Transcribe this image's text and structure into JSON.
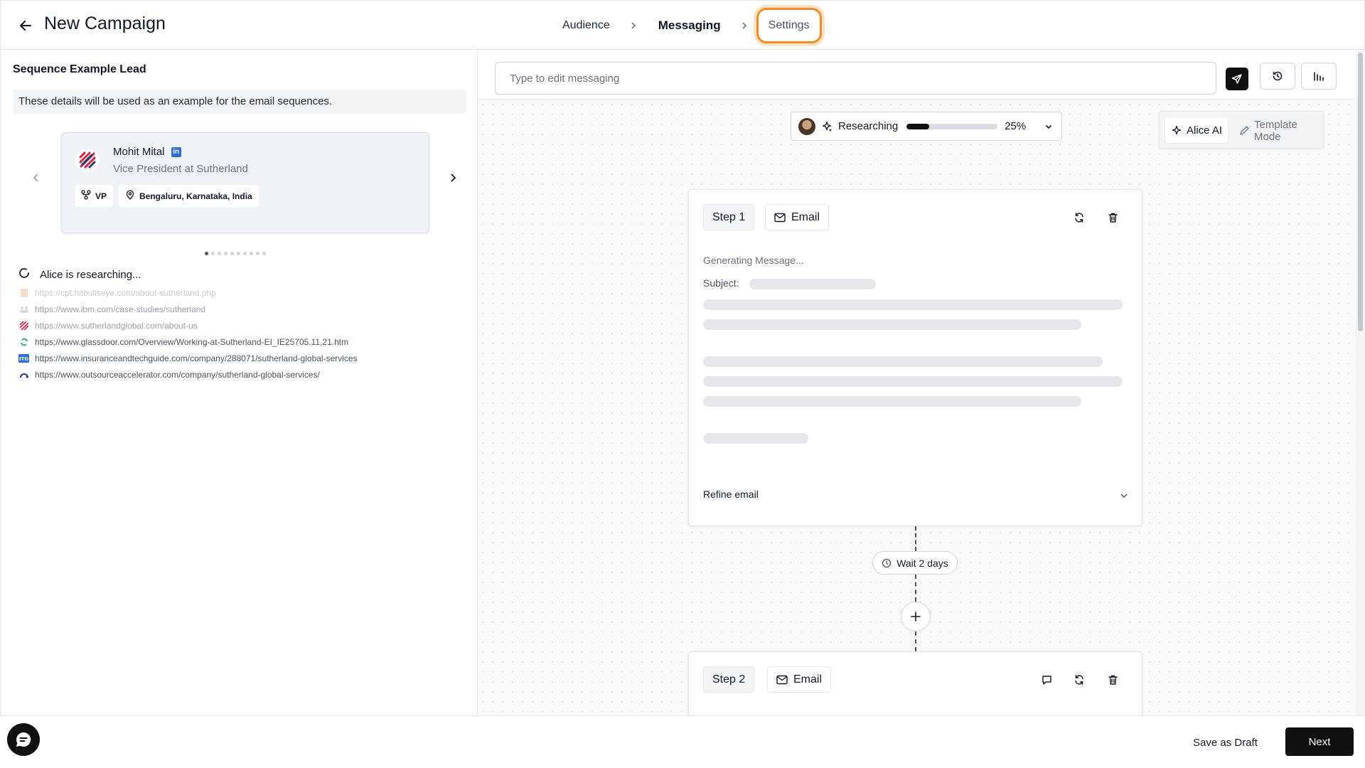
{
  "header": {
    "title": "New Campaign",
    "steps": [
      {
        "label": "Audience"
      },
      {
        "label": "Messaging"
      },
      {
        "label": "Settings"
      }
    ]
  },
  "lead_panel": {
    "title": "Sequence Example Lead",
    "note": "These details will be used as an example for the email sequences.",
    "lead": {
      "name": "Mohit Mital",
      "role": "Vice President at Sutherland",
      "seniority": "VP",
      "location": "Bengaluru, Karnataka, India"
    },
    "carousel": {
      "total": 10,
      "active_index": 0
    },
    "research_status": "Alice is researching...",
    "sources": [
      {
        "url": "https://cpt.hitbullseye.com/about-sutherland.php",
        "opacity": "faded",
        "icon": "document-icon"
      },
      {
        "url": "https://www.ibm.com/case-studies/sutherland",
        "opacity": "mid",
        "icon": "people-icon"
      },
      {
        "url": "https://www.sutherlandglobal.com/about-us",
        "opacity": "mid",
        "icon": "sutherland-logo-icon"
      },
      {
        "url": "https://www.glassdoor.com/Overview/Working-at-Sutherland-EI_IE25705.11,21.htm",
        "opacity": "full",
        "icon": "glassdoor-icon"
      },
      {
        "url": "https://www.insuranceandtechguide.com/company/288071/sutherland-global-services",
        "opacity": "full",
        "icon": "itg-logo-icon"
      },
      {
        "url": "https://www.outsourceaccelerator.com/company/sutherland-global-services/",
        "opacity": "full",
        "icon": "oa-logo-icon"
      }
    ]
  },
  "messaging": {
    "prompt_placeholder": "Type to edit messaging",
    "research": {
      "label": "Researching",
      "progress_percent": 25,
      "progress_text": "25%"
    },
    "modes": {
      "ai": "Alice AI",
      "template": "Template Mode"
    },
    "step1": {
      "step_label": "Step 1",
      "channel": "Email",
      "generating": "Generating Message...",
      "subject_label": "Subject:",
      "refine_label": "Refine email"
    },
    "wait": "Wait 2 days",
    "step2": {
      "step_label": "Step 2",
      "channel": "Email"
    }
  },
  "footer": {
    "draft_label": "Save as Draft",
    "next_label": "Next"
  },
  "colors": {
    "accent_highlight": "#f28c28",
    "primary_button": "#111111",
    "progress_fill": "#111111"
  }
}
